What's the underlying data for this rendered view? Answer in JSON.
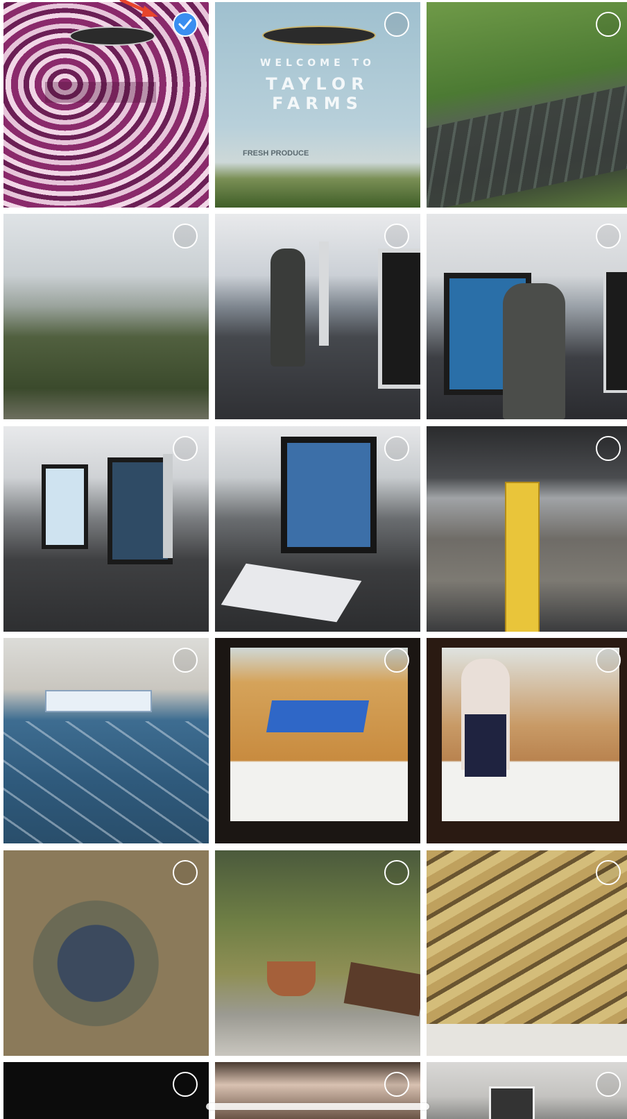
{
  "photos": {
    "tile_1": {
      "label": "Taylor Farms logo on red cabbage",
      "selected": true
    },
    "tile_2": {
      "welcome": "WELCOME TO",
      "brand_line1": "TAYLOR",
      "brand_line2": "FARMS",
      "badge": "FRESH PRODUCE",
      "selected": false
    },
    "tile_3": {
      "selected": false
    },
    "tile_4": {
      "selected": false
    },
    "tile_5": {
      "selected": false
    },
    "tile_6": {
      "selected": false
    },
    "tile_7": {
      "selected": false
    },
    "tile_8": {
      "selected": false
    },
    "tile_9": {
      "selected": false
    },
    "tile_10": {
      "selected": false
    },
    "tile_11": {
      "selected": false
    },
    "tile_12": {
      "selected": false
    },
    "tile_13": {
      "selected": false
    },
    "tile_14": {
      "selected": false
    },
    "tile_15": {
      "selected": false
    },
    "tile_16": {
      "selected": false
    },
    "tile_17": {
      "selected": false
    },
    "tile_18": {
      "selected": false
    }
  },
  "colors": {
    "accent": "#3a8ef0",
    "annotation_arrow": "#e8452c"
  }
}
